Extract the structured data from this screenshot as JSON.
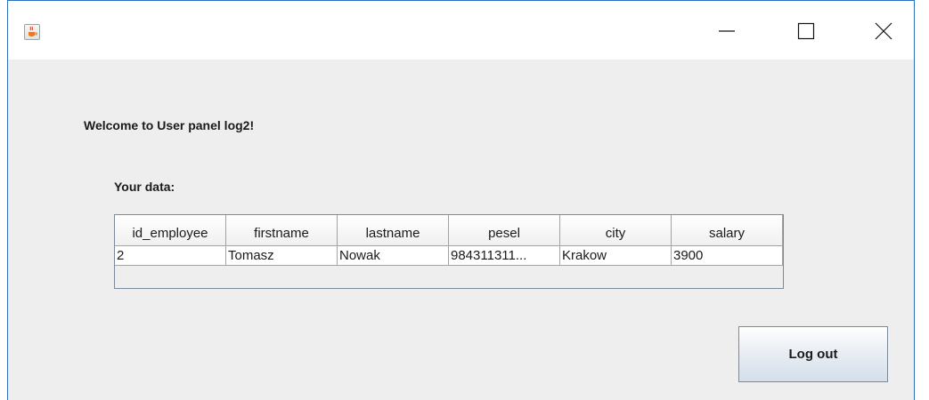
{
  "window": {
    "icon": "java-cup-icon",
    "controls": [
      "minimize-icon",
      "maximize-icon",
      "close-icon"
    ]
  },
  "content": {
    "welcome_text": "Welcome to User panel log2!",
    "your_data_label": "Your data:"
  },
  "table": {
    "columns": [
      "id_employee",
      "firstname",
      "lastname",
      "pesel",
      "city",
      "salary"
    ],
    "rows": [
      [
        "2",
        "Tomasz",
        "Nowak",
        "984311311...",
        "Krakow",
        "3900"
      ]
    ]
  },
  "actions": {
    "logout_label": "Log out"
  },
  "colors": {
    "window_border": "#2b6fbf",
    "panel_background": "#eeeeee"
  }
}
